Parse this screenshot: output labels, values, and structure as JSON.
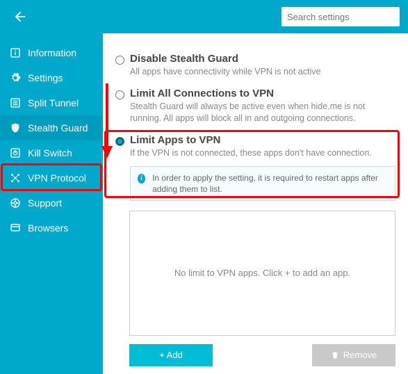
{
  "header": {
    "search_placeholder": "Search settings"
  },
  "sidebar": {
    "items": [
      {
        "label": "Information"
      },
      {
        "label": "Settings"
      },
      {
        "label": "Split Tunnel"
      },
      {
        "label": "Stealth Guard"
      },
      {
        "label": "Kill Switch"
      },
      {
        "label": "VPN Protocol"
      },
      {
        "label": "Support"
      },
      {
        "label": "Browsers"
      }
    ],
    "selected_index": 3
  },
  "options": {
    "disable": {
      "title": "Disable Stealth Guard",
      "desc": "All apps have connectivity while VPN is not active"
    },
    "limit_all": {
      "title": "Limit All Connections to VPN",
      "desc": "Stealth Guard will always be active even when hide.me is not running. All apps will block all in and outgoing connections."
    },
    "limit_apps": {
      "title": "Limit Apps to VPN",
      "desc": "If the VPN is not connected, these apps don't have connection.",
      "info": "In order to apply the setting, it is required to restart apps after adding them to list."
    },
    "selected": "limit_apps"
  },
  "list": {
    "empty_text": "No limit to VPN apps. Click + to add an app."
  },
  "actions": {
    "add": "+ Add",
    "remove": "Remove"
  },
  "colors": {
    "primary": "#00a8cc",
    "accent": "#00bcd4",
    "annotation": "#ff0000"
  }
}
